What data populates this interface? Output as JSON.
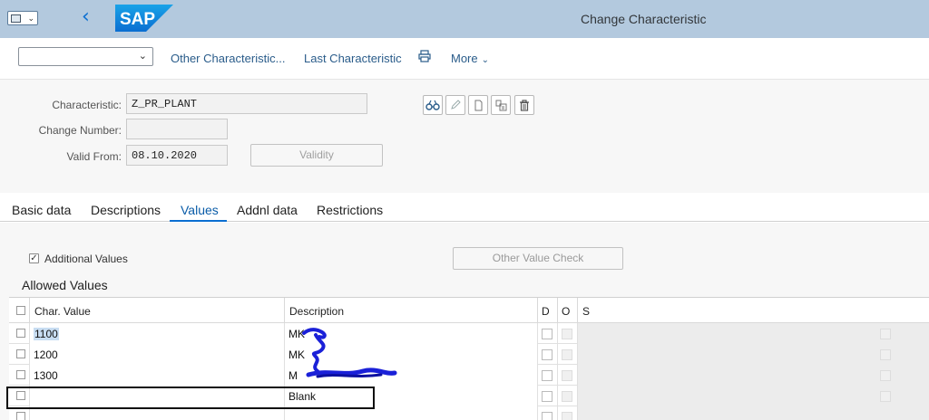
{
  "shell": {
    "title": "Change Characteristic",
    "logo_text": "SAP"
  },
  "toolbar": {
    "dropdown_value": "",
    "other_characteristic": "Other Characteristic...",
    "last_characteristic": "Last Characteristic",
    "more": "More"
  },
  "header": {
    "characteristic_label": "Characteristic:",
    "characteristic_value": "Z_PR_PLANT",
    "change_number_label": "Change Number:",
    "change_number_value": "",
    "valid_from_label": "Valid From:",
    "valid_from_value": "08.10.2020",
    "validity_button": "Validity"
  },
  "tabs": [
    {
      "label": "Basic data",
      "active": false
    },
    {
      "label": "Descriptions",
      "active": false
    },
    {
      "label": "Values",
      "active": true
    },
    {
      "label": "Addnl data",
      "active": false
    },
    {
      "label": "Restrictions",
      "active": false
    }
  ],
  "values": {
    "additional_values_label": "Additional Values",
    "additional_values_checked": true,
    "other_value_check": "Other Value Check",
    "allowed_values_title": "Allowed Values",
    "columns": {
      "char_value": "Char. Value",
      "description": "Description",
      "d": "D",
      "o": "O",
      "s": "S"
    },
    "rows": [
      {
        "char_value": "1100",
        "description": "MK"
      },
      {
        "char_value": "1200",
        "description": "MK"
      },
      {
        "char_value": "1300",
        "description": "M"
      },
      {
        "char_value": "",
        "description": "Blank"
      },
      {
        "char_value": "",
        "description": ""
      }
    ]
  },
  "icons": [
    "display-icon",
    "edit-icon",
    "create-icon",
    "copy-icon",
    "delete-icon",
    "print-icon",
    "back-icon",
    "menu-icon"
  ],
  "colors": {
    "shell_bg": "#b3c9de",
    "accent": "#0a6ed1",
    "link": "#2a5c8a"
  }
}
